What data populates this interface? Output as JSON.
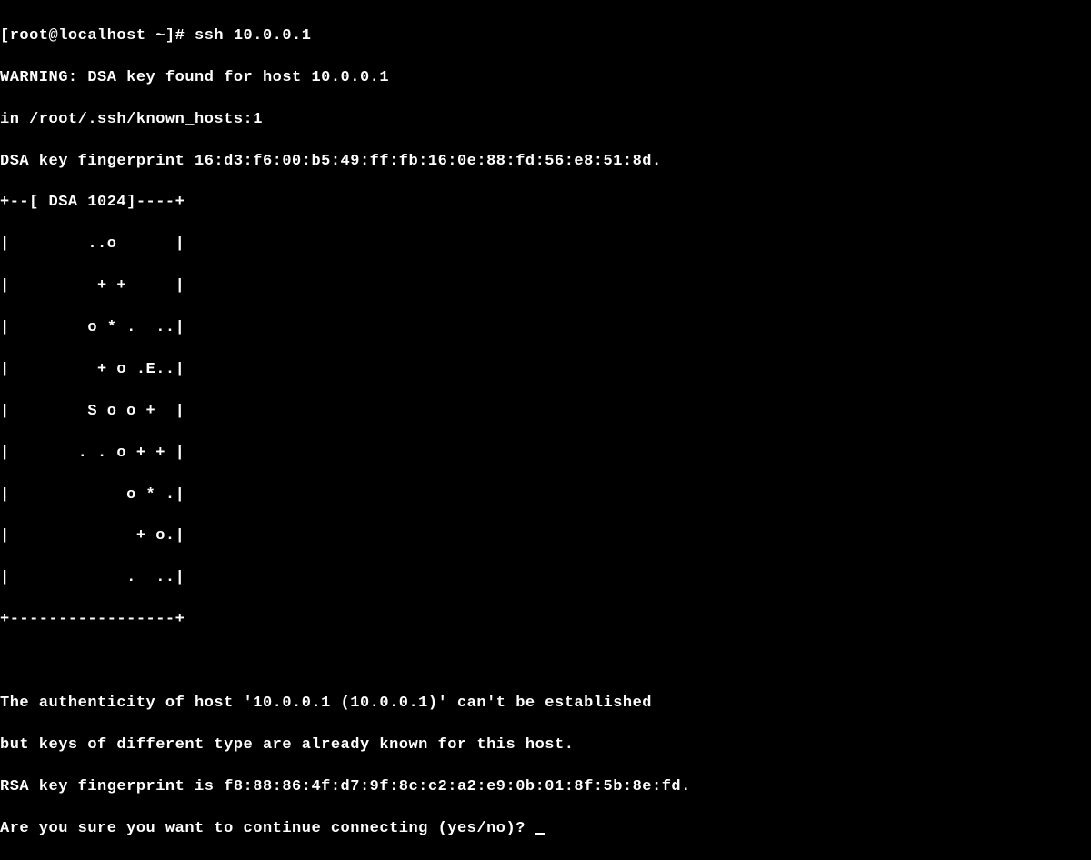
{
  "terminal": {
    "prompt_line": "[root@localhost ~]# ssh 10.0.0.1",
    "warning_line": "WARNING: DSA key found for host 10.0.0.1",
    "in_line": "in /root/.ssh/known_hosts:1",
    "dsa_fingerprint": "DSA key fingerprint 16:d3:f6:00:b5:49:ff:fb:16:0e:88:fd:56:e8:51:8d.",
    "art_top": "+--[ DSA 1024]----+",
    "art_01": "|        ..o      |",
    "art_02": "|         + +     |",
    "art_03": "|        o * .  ..|",
    "art_04": "|         + o .E..|",
    "art_05": "|        S o o +  |",
    "art_06": "|       . . o + + |",
    "art_07": "|            o * .|",
    "art_08": "|             + o.|",
    "art_09": "|            .  ..|",
    "art_bottom": "+-----------------+",
    "blank": " ",
    "auth_line": "The authenticity of host '10.0.0.1 (10.0.0.1)' can't be established",
    "but_line": "but keys of different type are already known for this host.",
    "rsa_fingerprint": "RSA key fingerprint is f8:88:86:4f:d7:9f:8c:c2:a2:e9:0b:01:8f:5b:8e:fd.",
    "prompt_question": "Are you sure you want to continue connecting (yes/no)? "
  }
}
